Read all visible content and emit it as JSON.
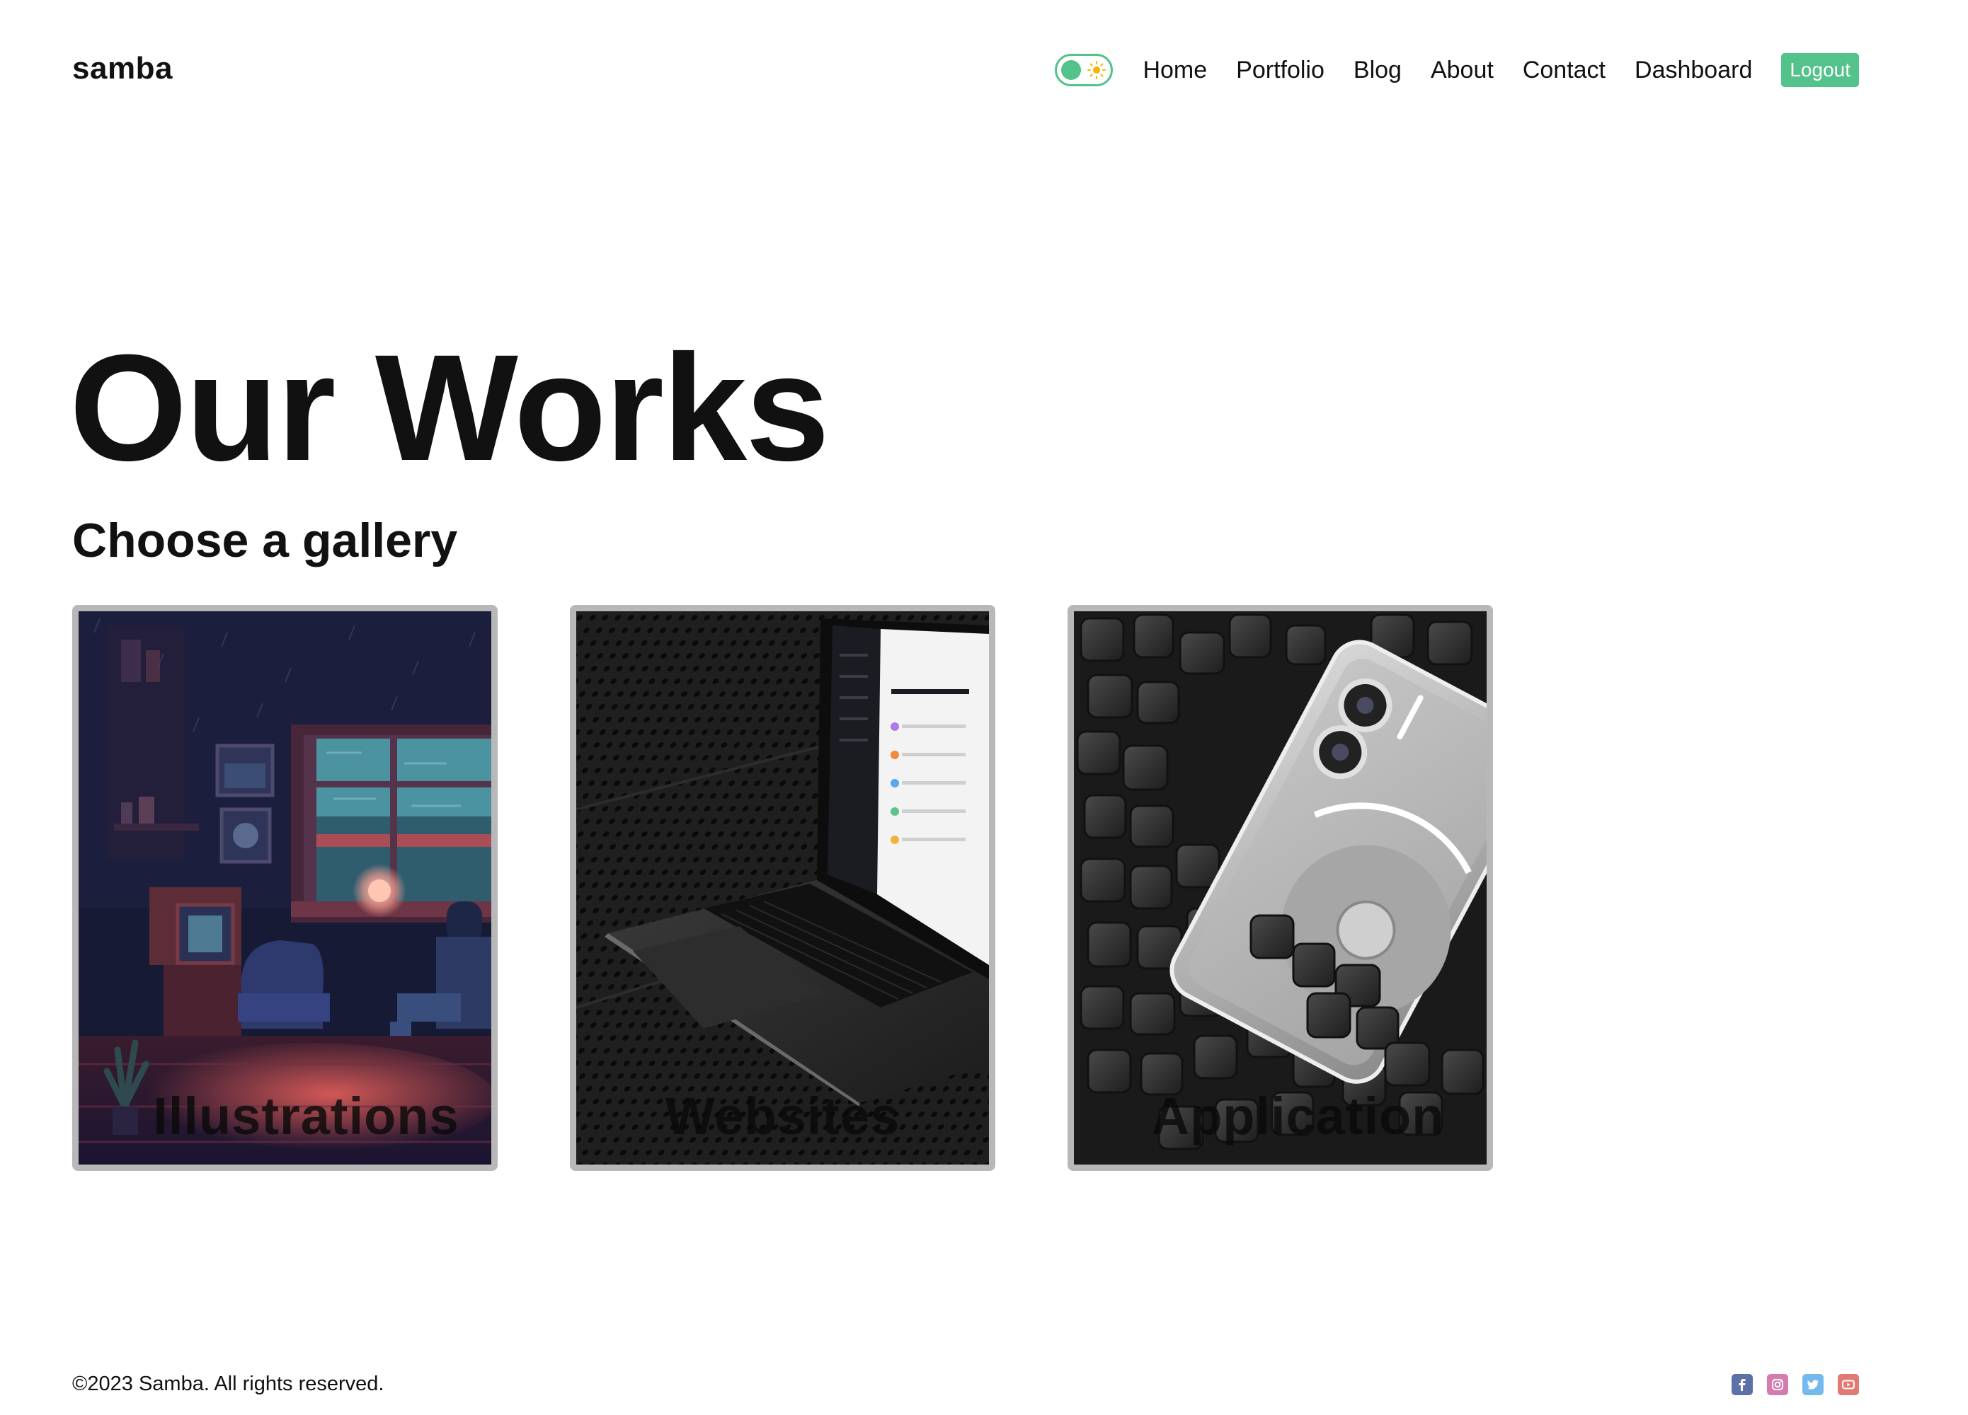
{
  "header": {
    "logo": "samba",
    "nav": {
      "home": "Home",
      "portfolio": "Portfolio",
      "blog": "Blog",
      "about": "About",
      "contact": "Contact",
      "dashboard": "Dashboard"
    },
    "logout_label": "Logout",
    "theme_toggle": {
      "state": "light",
      "icon": "sun-icon"
    }
  },
  "hero": {
    "title": "Our Works",
    "subtitle": "Choose a gallery"
  },
  "gallery": {
    "items": [
      {
        "label": "Illustrations",
        "image": "pixel-art-rainy-room"
      },
      {
        "label": "Websites",
        "image": "laptop-dark-perforated-surface"
      },
      {
        "label": "Application",
        "image": "white-phone-on-foam-cubes"
      }
    ]
  },
  "footer": {
    "copyright": "©2023 Samba. All rights reserved.",
    "socials": [
      {
        "name": "facebook-icon",
        "color": "#3b5998"
      },
      {
        "name": "instagram-icon",
        "color": "#c13584"
      },
      {
        "name": "twitter-icon",
        "color": "#1da1f2"
      },
      {
        "name": "youtube-icon",
        "color": "#d9534f"
      }
    ]
  },
  "colors": {
    "accent": "#53c28b",
    "card_border": "#b8b8b8",
    "text": "#111111"
  }
}
